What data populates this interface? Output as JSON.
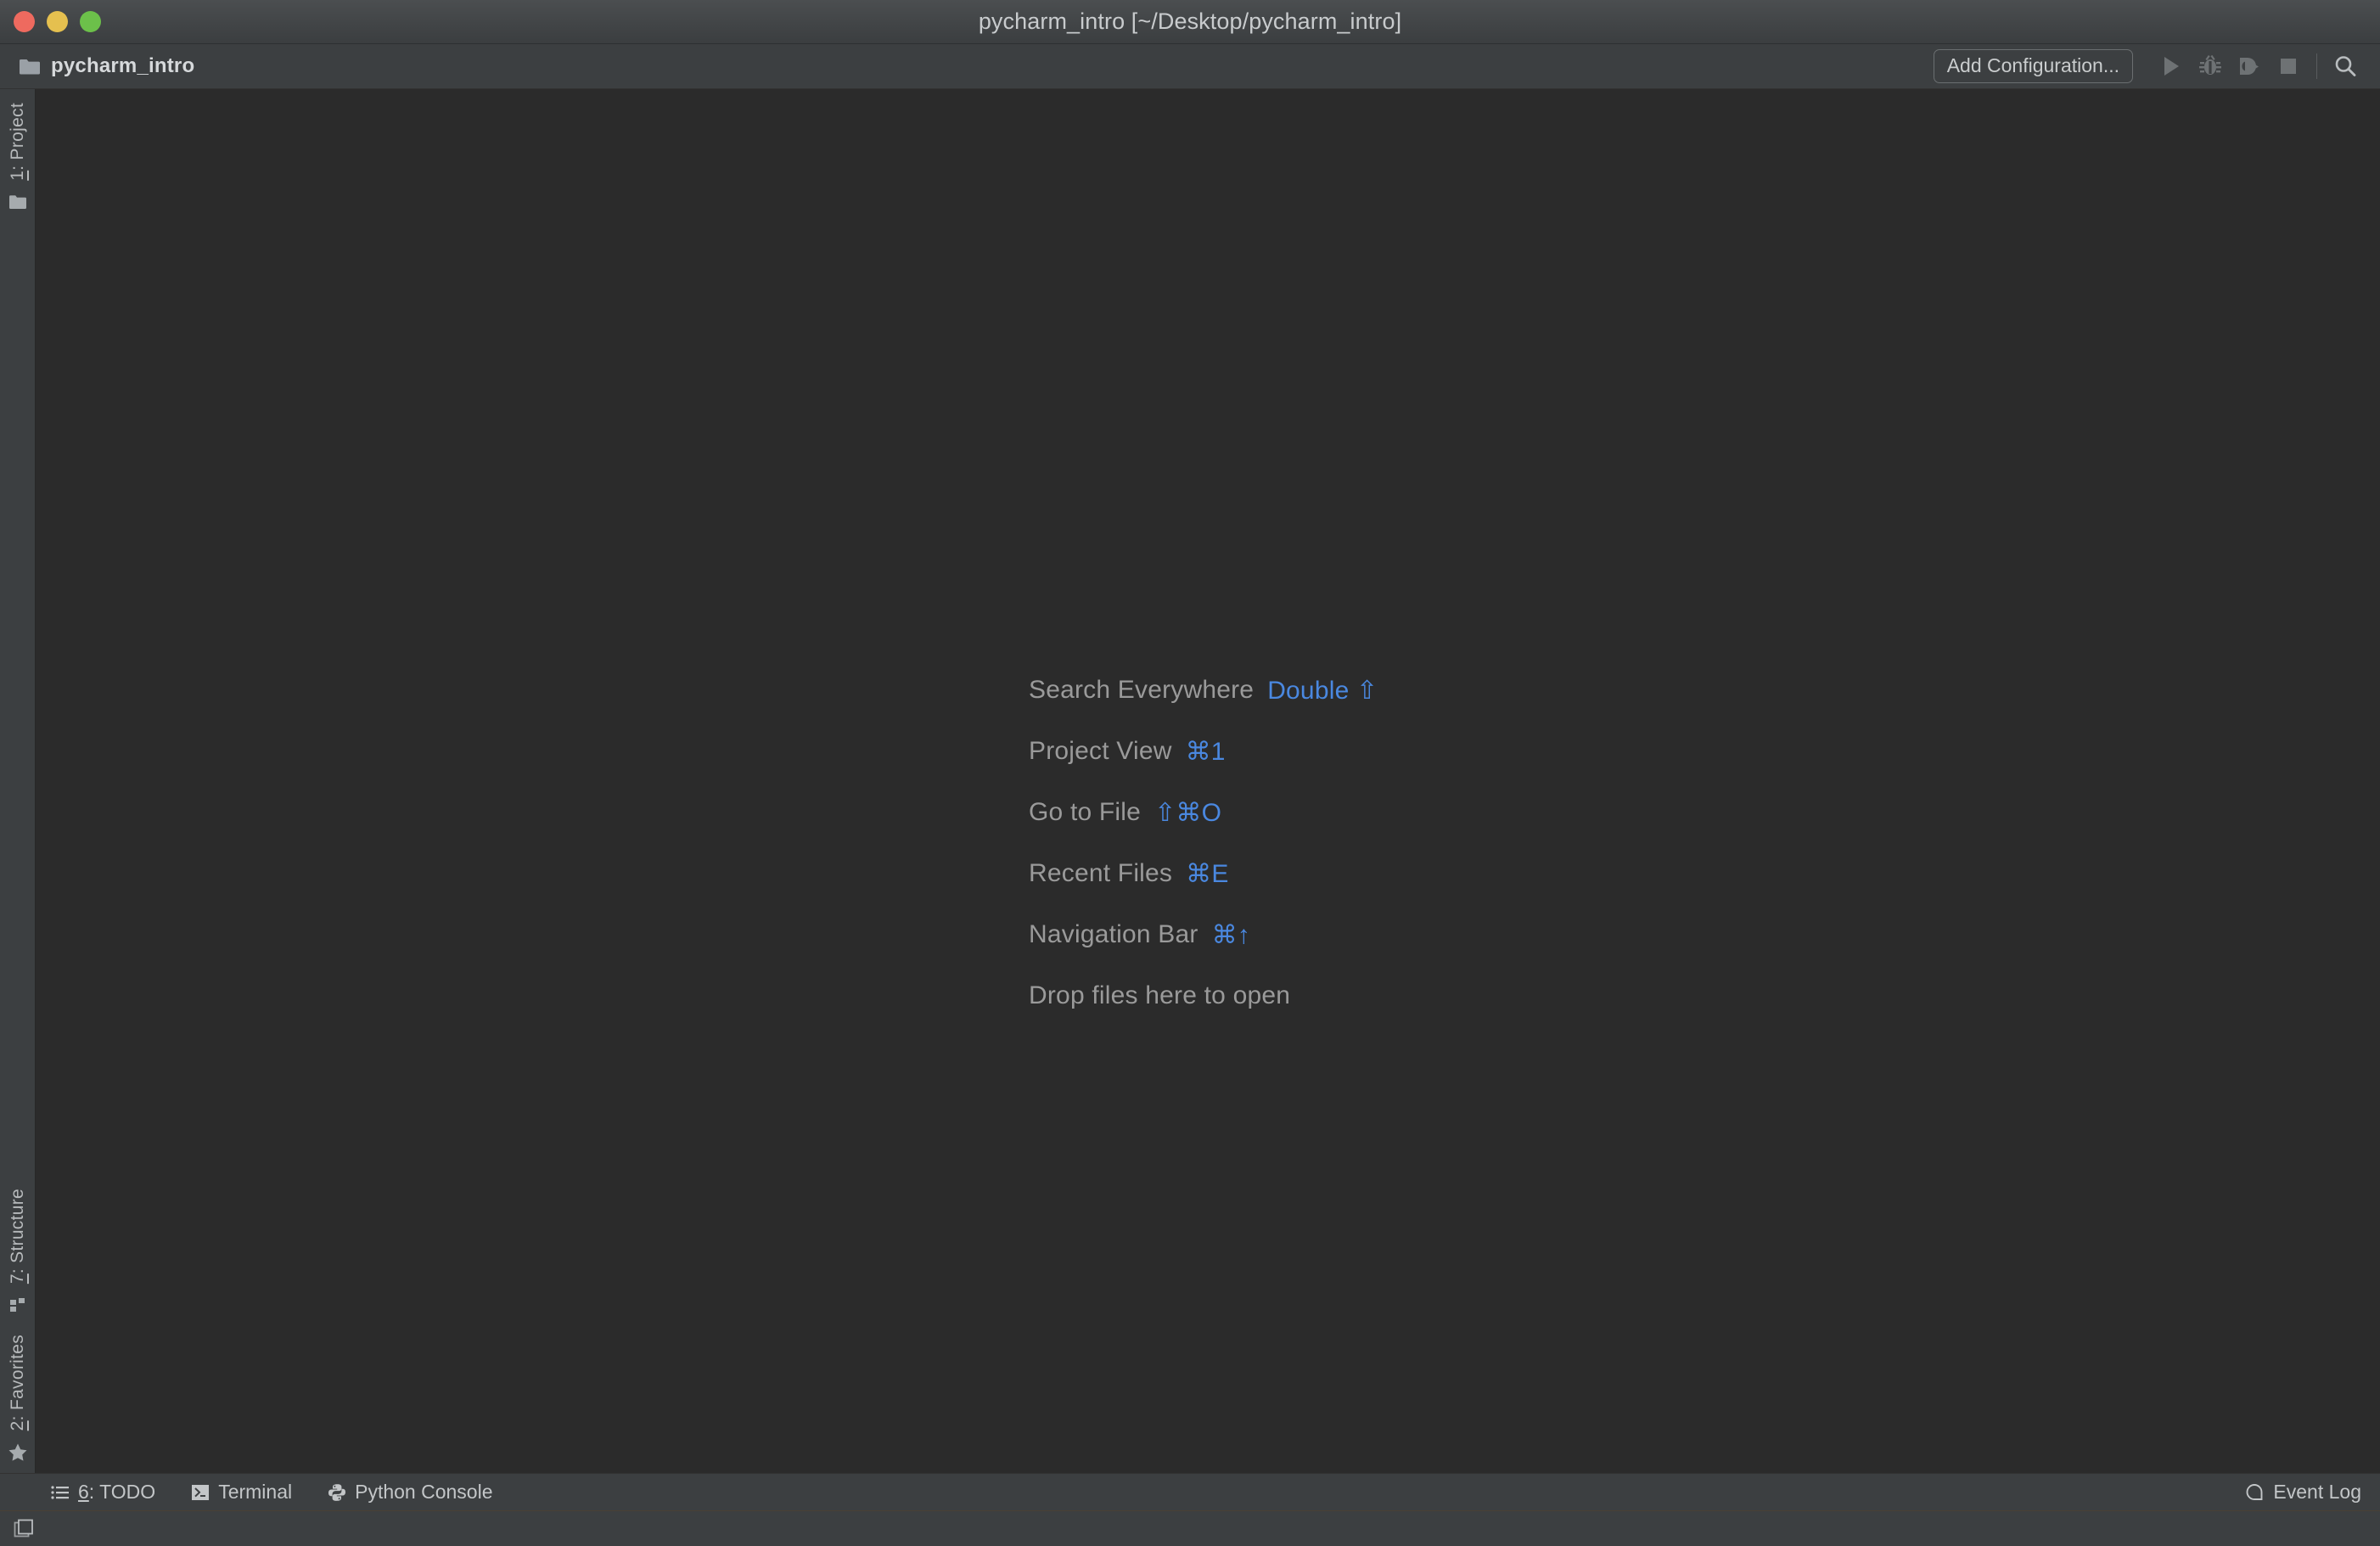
{
  "window": {
    "title": "pycharm_intro [~/Desktop/pycharm_intro]",
    "traffic_lights": [
      {
        "name": "close",
        "color": "#ee6a5f"
      },
      {
        "name": "minimize",
        "color": "#e5c04f"
      },
      {
        "name": "maximize",
        "color": "#6cc04a"
      }
    ]
  },
  "toolbar": {
    "project_name": "pycharm_intro",
    "folder_icon": "folder-icon",
    "add_configuration_label": "Add Configuration...",
    "actions": [
      {
        "name": "run-icon",
        "label": "Run"
      },
      {
        "name": "debug-icon",
        "label": "Debug"
      },
      {
        "name": "run-with-coverage-icon",
        "label": "Run with Coverage"
      },
      {
        "name": "stop-icon",
        "label": "Stop"
      }
    ],
    "search_icon": "search-icon"
  },
  "sidebar": {
    "top_items": [
      {
        "label_num": "1",
        "label_text": ": Project",
        "icon": "project-folder-icon"
      }
    ],
    "bottom_items": [
      {
        "label_num": "7",
        "label_text": ": Structure",
        "icon": "structure-icon"
      },
      {
        "label_num": "2",
        "label_text": ": Favorites",
        "icon": "star-icon"
      }
    ]
  },
  "editor": {
    "hints": [
      {
        "label": "Search Everywhere",
        "key": "Double ⇧"
      },
      {
        "label": "Project View",
        "key": "⌘1"
      },
      {
        "label": "Go to File",
        "key": "⇧⌘O"
      },
      {
        "label": "Recent Files",
        "key": "⌘E"
      },
      {
        "label": "Navigation Bar",
        "key": "⌘↑"
      },
      {
        "label": "Drop files here to open",
        "key": ""
      }
    ],
    "label_color": "#9a9a9a",
    "key_color": "#4a88e0",
    "background": "#2b2b2b"
  },
  "statusbar": {
    "items": [
      {
        "num": "6",
        "label": ": TODO",
        "icon": "todo-list-icon"
      },
      {
        "num": "",
        "label": "Terminal",
        "icon": "terminal-icon"
      },
      {
        "num": "",
        "label": "Python Console",
        "icon": "python-icon"
      }
    ],
    "event_log_label": "Event Log",
    "event_log_icon": "event-log-icon",
    "bottom_icon": "layout-toggle-icon"
  }
}
